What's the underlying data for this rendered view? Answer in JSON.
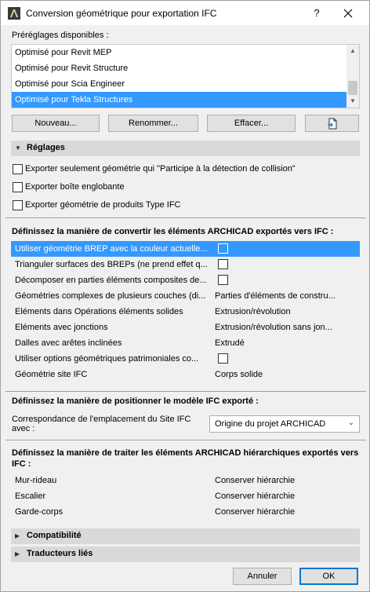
{
  "window": {
    "title": "Conversion géométrique pour exportation IFC",
    "help_label": "?"
  },
  "presets": {
    "label": "Préréglages disponibles :",
    "items": [
      "Optimisé pour Revit MEP",
      "Optimisé pour Revit Structure",
      "Optimisé pour Scia Engineer",
      "Optimisé pour Tekla Structures"
    ],
    "selected_index": 3,
    "buttons": {
      "new": "Nouveau...",
      "rename": "Renommer...",
      "delete": "Effacer..."
    }
  },
  "reglages": {
    "title": "Réglages",
    "checkboxes": [
      {
        "label": "Exporter seulement géométrie qui \"Participe à la détection de collision\"",
        "checked": false
      },
      {
        "label": "Exporter boîte englobante",
        "checked": false
      },
      {
        "label": "Exporter géométrie de produits Type IFC",
        "checked": false
      }
    ]
  },
  "convert": {
    "heading": "Définissez la manière de convertir les éléments ARCHICAD exportés vers IFC :",
    "rows": [
      {
        "label": "Utiliser géométrie BREP avec la couleur actuelle...",
        "kind": "checkbox",
        "value": "",
        "selected": true
      },
      {
        "label": "Trianguler surfaces des BREPs (ne prend effet q...",
        "kind": "checkbox",
        "value": ""
      },
      {
        "label": "Décomposer en parties éléments composites de...",
        "kind": "checkbox",
        "value": ""
      },
      {
        "label": "Géométries complexes de plusieurs couches (di...",
        "kind": "text",
        "value": "Parties d'éléments de constru..."
      },
      {
        "label": "Eléments dans Opérations éléments solides",
        "kind": "text",
        "value": "Extrusion/révolution"
      },
      {
        "label": "Eléments avec jonctions",
        "kind": "text",
        "value": "Extrusion/révolution sans jon..."
      },
      {
        "label": "Dalles avec arêtes inclinées",
        "kind": "text",
        "value": "Extrudé"
      },
      {
        "label": "Utiliser options géométriques patrimoniales co...",
        "kind": "checkbox",
        "value": ""
      },
      {
        "label": "Géométrie site IFC",
        "kind": "text",
        "value": "Corps solide"
      }
    ]
  },
  "position": {
    "heading": "Définissez la manière de positionner le modèle IFC exporté :",
    "site_label_line1": "Correspondance de l'emplacement du Site IFC",
    "site_label_line2": "avec :",
    "site_value": "Origine du projet ARCHICAD"
  },
  "hierarchy": {
    "heading_line1": "Définissez la manière de traiter les éléments ARCHICAD hiérarchiques exportés vers",
    "heading_line2": "IFC :",
    "rows": [
      {
        "label": "Mur-rideau",
        "value": "Conserver hiérarchie"
      },
      {
        "label": "Escalier",
        "value": "Conserver hiérarchie"
      },
      {
        "label": "Garde-corps",
        "value": "Conserver hiérarchie"
      }
    ]
  },
  "collapsed_sections": {
    "compat": "Compatibilité",
    "translators": "Traducteurs liés"
  },
  "footer": {
    "cancel": "Annuler",
    "ok": "OK"
  },
  "colors": {
    "selection": "#3399ff",
    "section_bar": "#d9d9d9",
    "default_button_border": "#0078d7"
  },
  "icons": [
    "archicad-app-icon",
    "close-icon",
    "chevron-up-icon",
    "chevron-down-icon",
    "import-preset-icon",
    "disclosure-triangle-icon",
    "dropdown-arrow-icon"
  ]
}
